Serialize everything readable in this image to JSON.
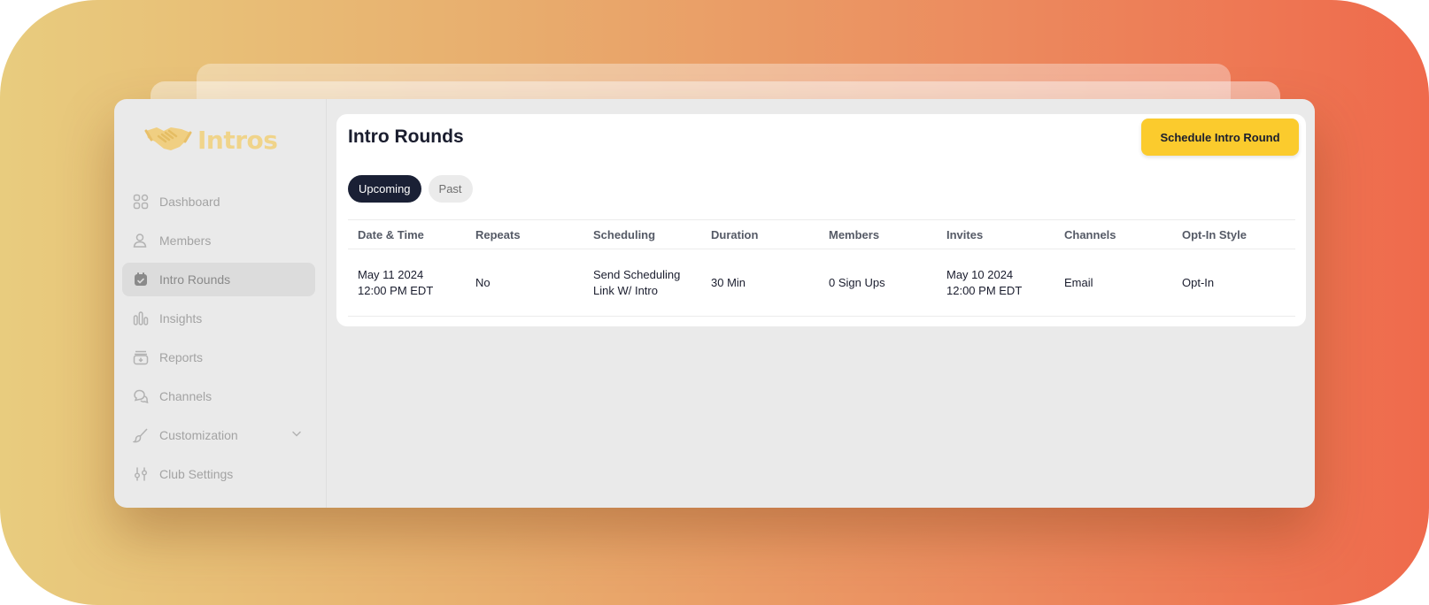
{
  "app": {
    "logo_text": "Intros",
    "brand_color": "#f0d48a",
    "accent_color": "#fbcb2d"
  },
  "sidebar": {
    "items": [
      {
        "label": "Dashboard",
        "icon": "grid-icon"
      },
      {
        "label": "Members",
        "icon": "user-icon"
      },
      {
        "label": "Intro Rounds",
        "icon": "calendar-icon",
        "active": true
      },
      {
        "label": "Insights",
        "icon": "bars-icon"
      },
      {
        "label": "Reports",
        "icon": "folder-icon"
      },
      {
        "label": "Channels",
        "icon": "chat-icon"
      },
      {
        "label": "Customization",
        "icon": "brush-icon",
        "expandable": true
      },
      {
        "label": "Club Settings",
        "icon": "sliders-icon"
      }
    ]
  },
  "main": {
    "title": "Intro Rounds",
    "cta_label": "Schedule Intro Round",
    "tabs": [
      {
        "label": "Upcoming",
        "selected": true
      },
      {
        "label": "Past",
        "selected": false
      }
    ],
    "table": {
      "columns": [
        "Date & Time",
        "Repeats",
        "Scheduling",
        "Duration",
        "Members",
        "Invites",
        "Channels",
        "Opt-In Style"
      ],
      "rows": [
        [
          "May 11 2024\n12:00 PM EDT",
          "No",
          "Send Scheduling\nLink W/ Intro",
          "30 Min",
          "0 Sign Ups",
          "May 10 2024\n12:00 PM EDT",
          "Email",
          "Opt-In"
        ]
      ]
    }
  }
}
